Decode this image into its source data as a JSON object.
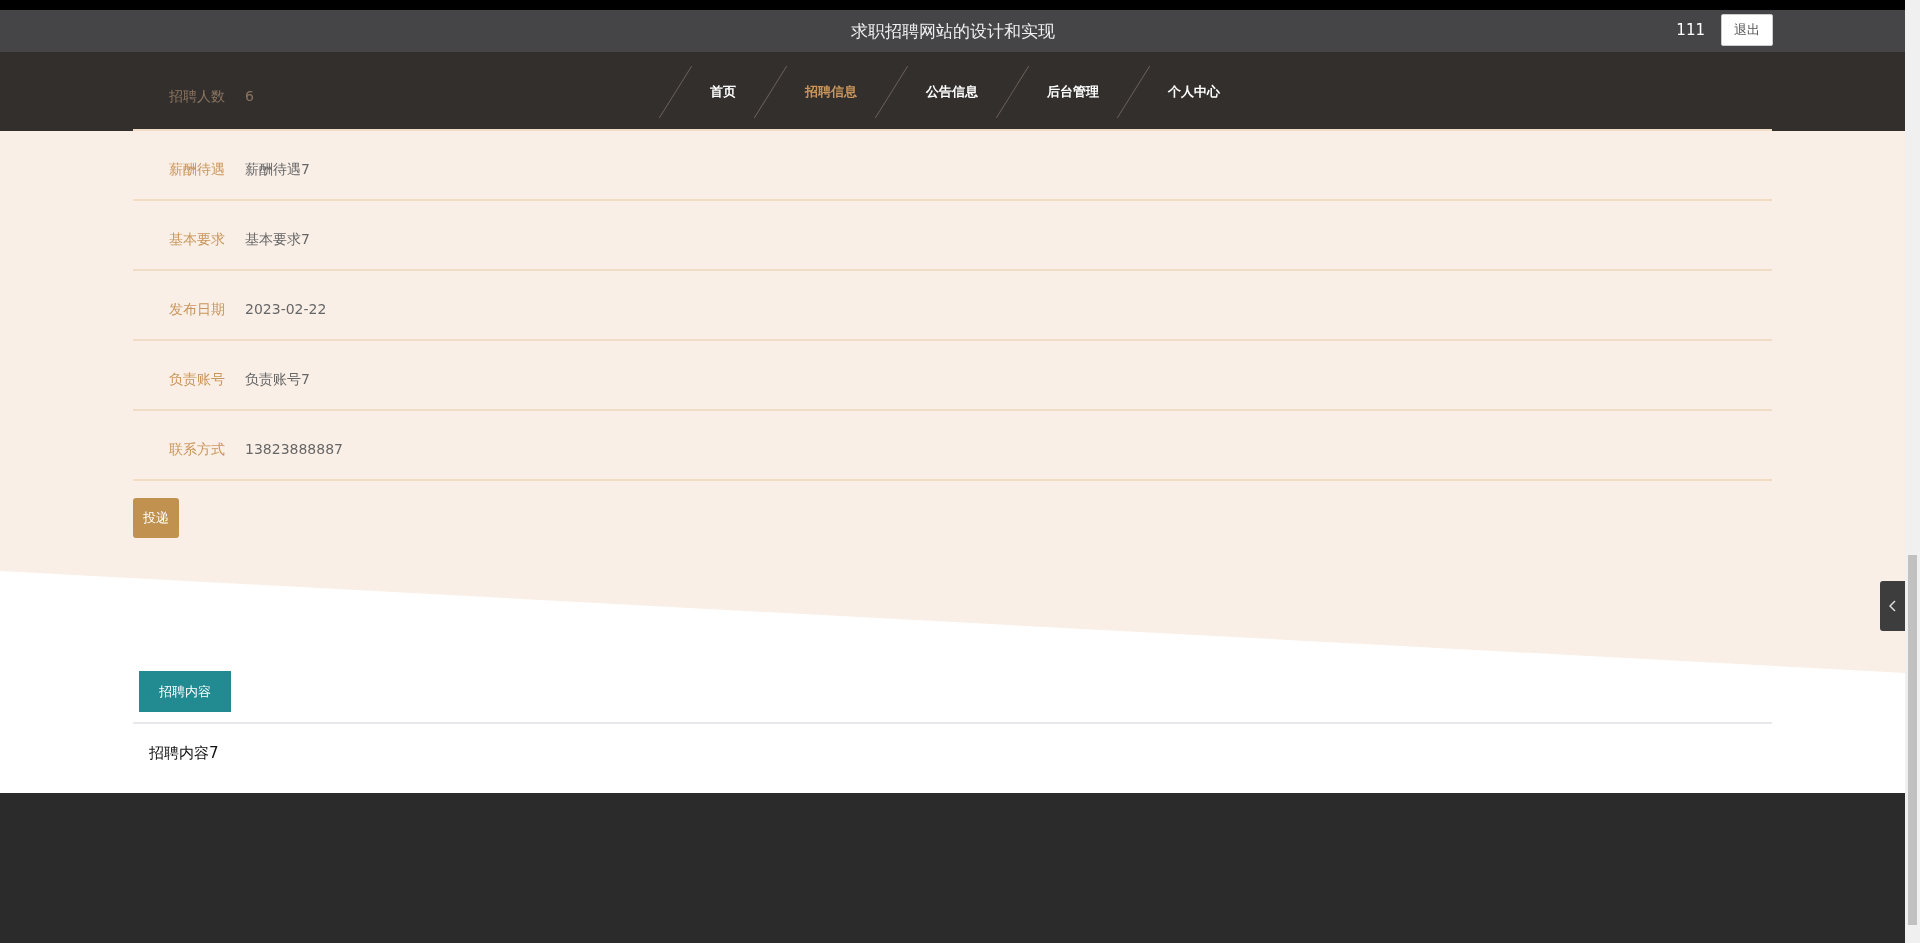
{
  "header": {
    "title": "求职招聘网站的设计和实现",
    "username": "111",
    "logout": "退出"
  },
  "nav": [
    {
      "label": "首页",
      "selected": false
    },
    {
      "label": "招聘信息",
      "selected": true
    },
    {
      "label": "公告信息",
      "selected": false
    },
    {
      "label": "后台管理",
      "selected": false
    },
    {
      "label": "个人中心",
      "selected": false
    }
  ],
  "details": [
    {
      "label": "招聘人数",
      "value": "6"
    },
    {
      "label": "薪酬待遇",
      "value": "薪酬待遇7"
    },
    {
      "label": "基本要求",
      "value": "基本要求7"
    },
    {
      "label": "发布日期",
      "value": "2023-02-22"
    },
    {
      "label": "负责账号",
      "value": "负责账号7"
    },
    {
      "label": "联系方式",
      "value": "13823888887"
    }
  ],
  "apply_button": "投递",
  "tabs": [
    {
      "label": "招聘内容",
      "selected": true
    }
  ],
  "content": "招聘内容7"
}
